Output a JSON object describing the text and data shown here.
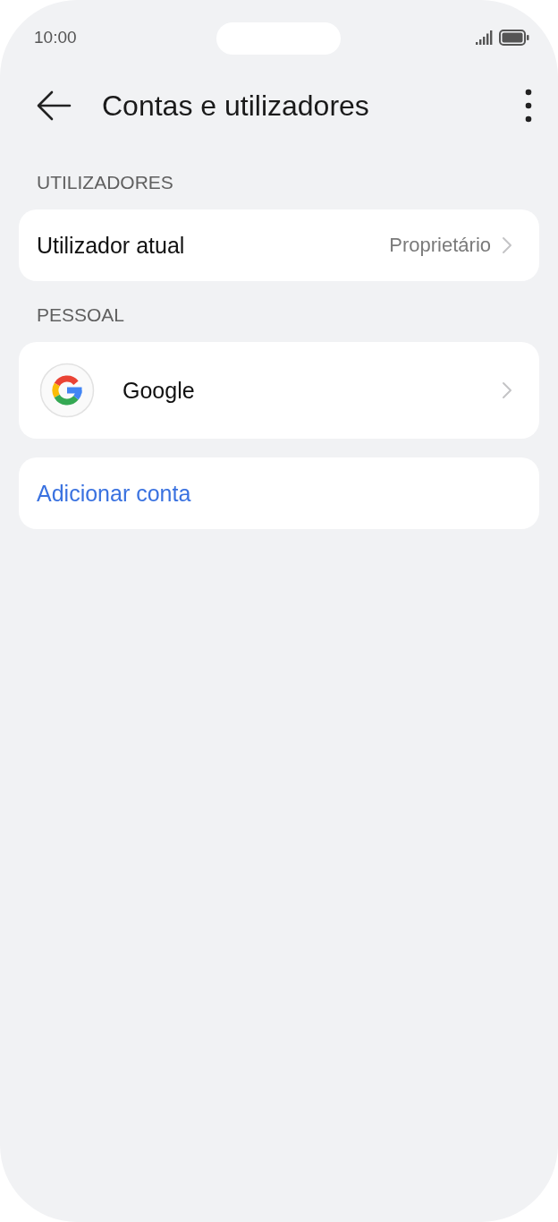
{
  "status_bar": {
    "time": "10:00"
  },
  "header": {
    "title": "Contas e utilizadores"
  },
  "sections": [
    {
      "title": "UTILIZADORES",
      "rows": [
        {
          "kind": "detail",
          "label": "Utilizador atual",
          "value": "Proprietário"
        }
      ]
    },
    {
      "title": "PESSOAL",
      "rows": [
        {
          "kind": "account",
          "label": "Google"
        }
      ]
    },
    {
      "rows": [
        {
          "kind": "action",
          "label": "Adicionar conta"
        }
      ]
    }
  ]
}
